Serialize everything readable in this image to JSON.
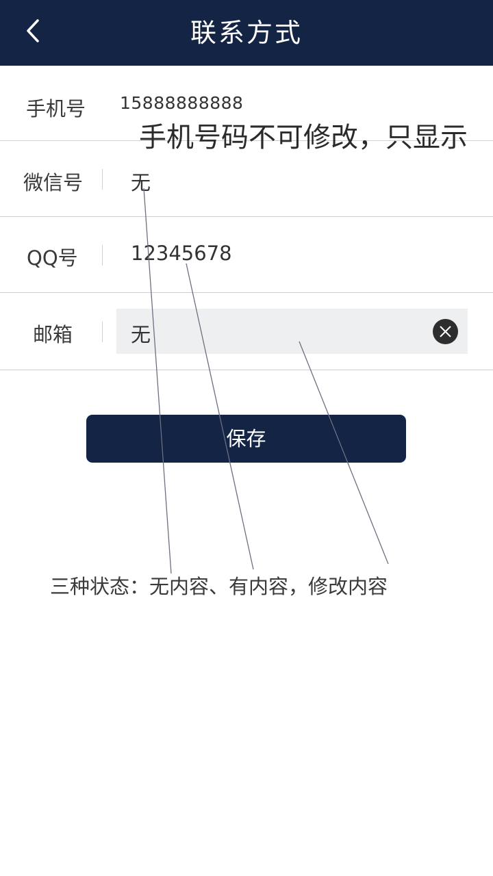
{
  "header": {
    "title": "联系方式",
    "back_icon": "chevron-left-icon",
    "background_color": "#142444"
  },
  "form": {
    "phone": {
      "label": "手机号",
      "value": "15888888888",
      "note": "手机号码不可修改，只显示"
    },
    "wechat": {
      "label": "微信号",
      "value": "无"
    },
    "qq": {
      "label": "QQ号",
      "value": "12345678"
    },
    "email": {
      "label": "邮箱",
      "value": "无",
      "clear_icon": "clear-circle-icon"
    }
  },
  "save_button": {
    "label": "保存",
    "color": "#142444"
  },
  "annotation": {
    "text": "三种状态：无内容、有内容，修改内容"
  }
}
